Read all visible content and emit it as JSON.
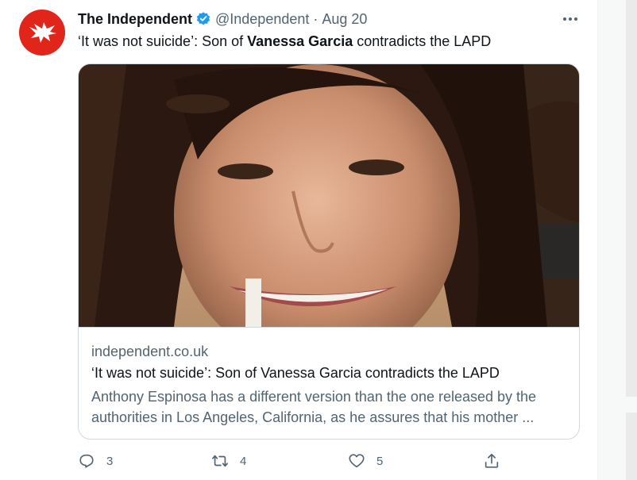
{
  "tweet": {
    "author_name": "The Independent",
    "handle": "@Independent",
    "separator": "·",
    "date": "Aug 20",
    "text_prefix": "‘It was not suicide’: Son of ",
    "text_bold": "Vanessa Garcia",
    "text_suffix": " contradicts the LAPD",
    "avatar_icon": "independent-eagle-logo",
    "verified_icon": "verified-badge-icon",
    "colors": {
      "brand_red": "#e1251b",
      "verified_blue": "#1d9bf0",
      "secondary_text": "#536471"
    }
  },
  "card": {
    "image_alt": "photo of a smiling woman on a beach",
    "domain": "independent.co.uk",
    "title": "‘It was not suicide’: Son of Vanessa Garcia contradicts the LAPD",
    "description": "Anthony Espinosa has a different version than the one released by the authorities in Los Angeles, California, as he assures that his mother ..."
  },
  "actions": {
    "reply_count": "3",
    "retweet_count": "4",
    "like_count": "5",
    "reply_icon": "reply-bubble-icon",
    "retweet_icon": "retweet-icon",
    "like_icon": "heart-icon",
    "share_icon": "share-icon"
  }
}
